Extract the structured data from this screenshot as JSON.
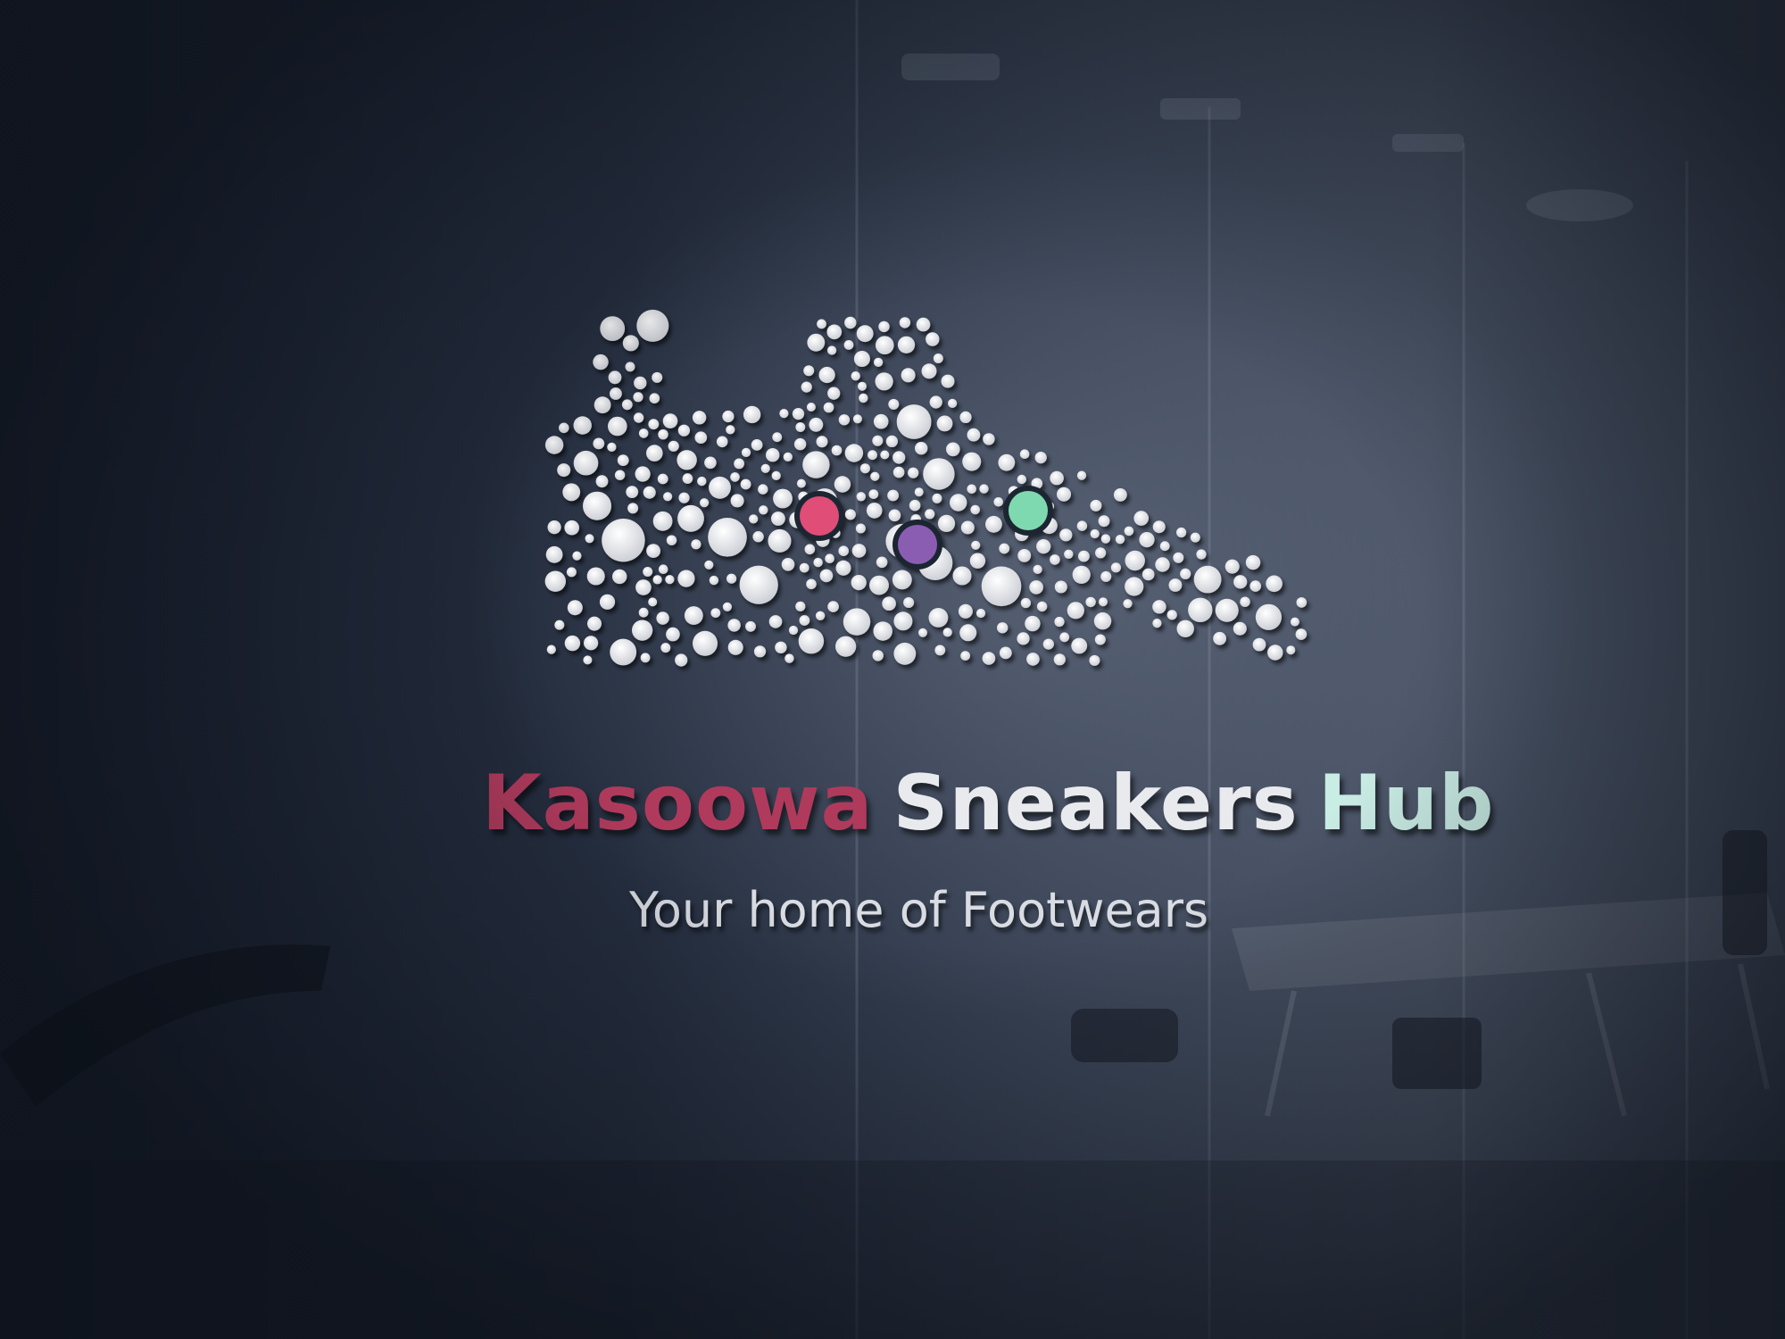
{
  "brand": {
    "word1": "Kasoowa",
    "word2": "Sneakers",
    "word3": "Hub",
    "tagline": "Your home of Footwears"
  },
  "colors": {
    "word1": "#b03a5c",
    "word2": "#e9eaed",
    "word3": "#c9ece4",
    "accent_pink": "#e04e76",
    "accent_purple": "#8a5db3",
    "accent_green": "#7fd9b0",
    "dot_white": "#eceef2",
    "wall_dark": "#1d2533"
  }
}
